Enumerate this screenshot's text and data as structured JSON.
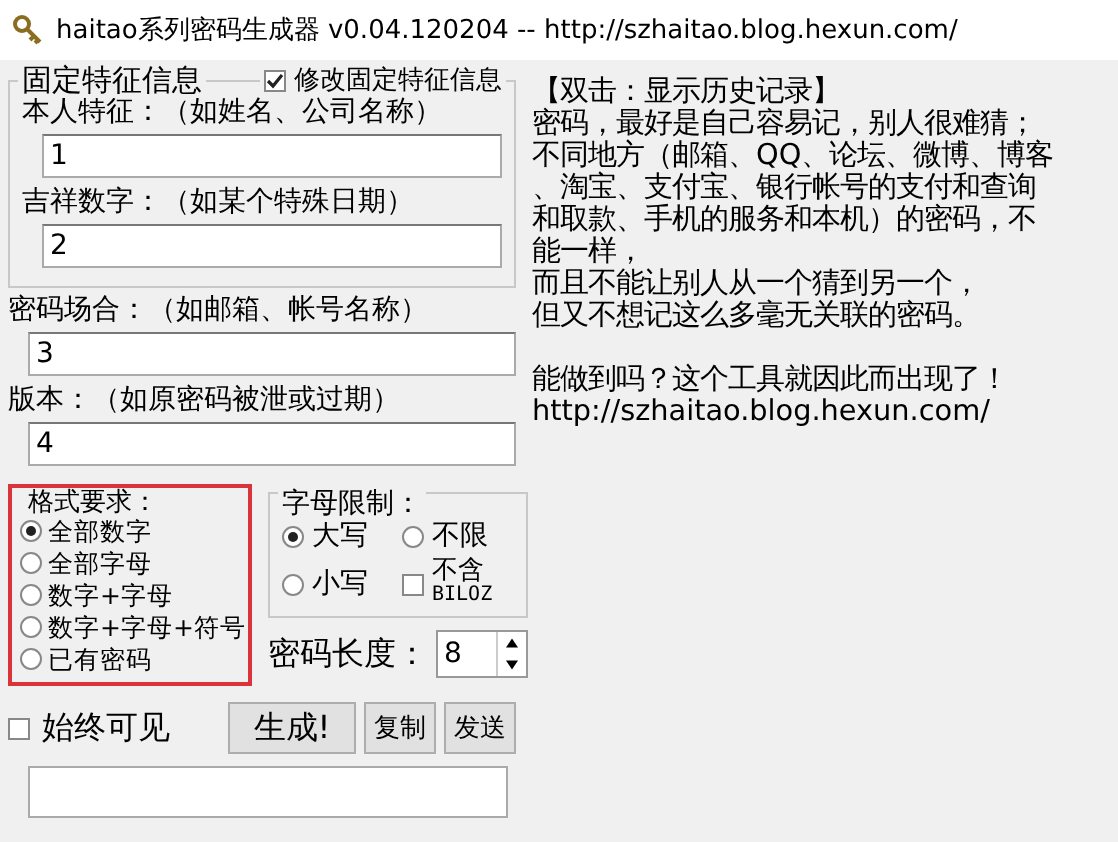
{
  "window": {
    "title": "haitao系列密码生成器 v0.04.120204 -- http://szhaitao.blog.hexun.com/"
  },
  "fixed_info": {
    "legend": "固定特征信息",
    "edit_checkbox": {
      "label": "修改固定特征信息",
      "checked": true
    },
    "fields": [
      {
        "label": "本人特征：（如姓名、公司名称）",
        "value": "1"
      },
      {
        "label": "吉祥数字：（如某个特殊日期）",
        "value": "2"
      }
    ]
  },
  "fields": [
    {
      "label": "密码场合：（如邮箱、帐号名称）",
      "value": "3"
    },
    {
      "label": "版本：（如原密码被泄或过期）",
      "value": "4"
    }
  ],
  "format": {
    "legend": "格式要求：",
    "options": [
      {
        "label": "全部数字",
        "selected": true
      },
      {
        "label": "全部字母",
        "selected": false
      },
      {
        "label": "数字+字母",
        "selected": false
      },
      {
        "label": "数字+字母+符号",
        "selected": false
      },
      {
        "label": "已有密码",
        "selected": false
      }
    ]
  },
  "letters": {
    "legend": "字母限制：",
    "options": [
      {
        "label": "大写",
        "selected": true
      },
      {
        "label": "不限",
        "selected": false
      },
      {
        "label": "小写",
        "selected": false
      }
    ],
    "exclude_checkbox": {
      "label": "不含",
      "sublabel": "BILOZ",
      "checked": false
    }
  },
  "length": {
    "label": "密码长度：",
    "value": "8"
  },
  "always_visible": {
    "label": "始终可见",
    "checked": false
  },
  "buttons": [
    "生成!",
    "复制",
    "发送"
  ],
  "notes": [
    [
      "【双击：显示历史记录】",
      "密码，最好是自己容易记，别人很难猜；",
      "不同地方（邮箱、QQ、论坛、微博、博客",
      "、淘宝、支付宝、银行帐号的支付和查询",
      "和取款、手机的服务和本机）的密码，不",
      "能一样，",
      "而且不能让别人从一个猜到另一个，",
      "但又不想记这么多毫无关联的密码。"
    ],
    [
      "能做到吗？这个工具就因此而出现了！",
      "http://szhaitao.blog.hexun.com/"
    ]
  ]
}
